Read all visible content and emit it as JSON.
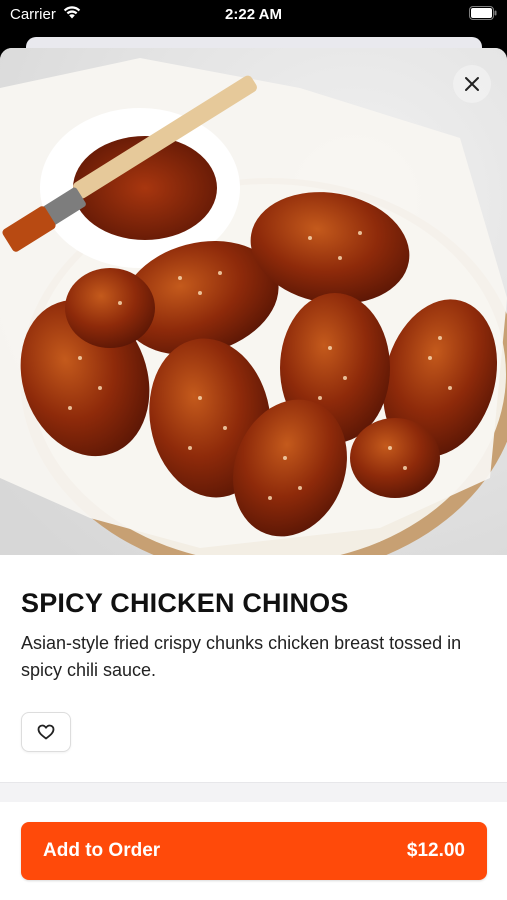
{
  "status_bar": {
    "carrier": "Carrier",
    "time": "2:22 AM",
    "wifi_icon": "wifi-icon",
    "battery_icon": "battery-icon"
  },
  "item": {
    "name": "SPICY CHICKEN CHINOS",
    "description": "Asian-style fried crispy chunks chicken breast tossed in spicy chili sauce.",
    "image_icon": "food-photo"
  },
  "actions": {
    "close_icon": "close-icon",
    "favorite_icon": "heart-icon",
    "add_label": "Add to Order",
    "price": "$12.00"
  },
  "colors": {
    "accent": "#ff4a0a",
    "text": "#111111",
    "divider": "#f3f3f5"
  }
}
